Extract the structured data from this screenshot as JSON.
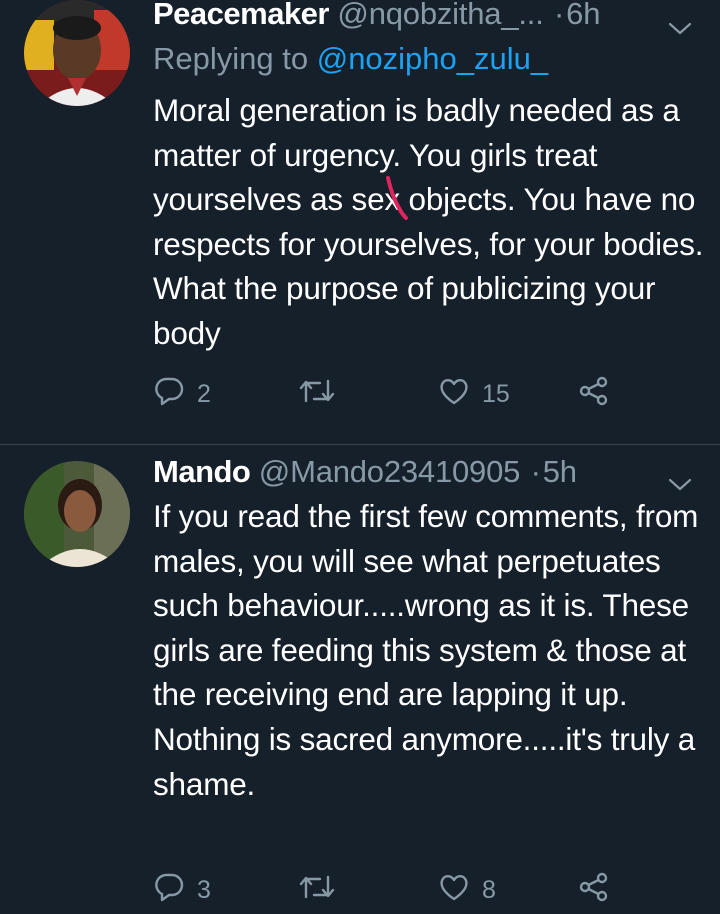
{
  "tweets": [
    {
      "name": "Peacemaker",
      "handle": "@nqobzitha_...",
      "time": "6h",
      "replying_prefix": "Replying to",
      "replying_to": "@nozipho_zulu_",
      "text": "Moral generation is badly needed as a matter of urgency. You girls treat yourselves as sex objects. You have no respects for yourselves, for your bodies. What the purpose of publicizing your body",
      "reply_count": "2",
      "retweet_count": "",
      "like_count": "15"
    },
    {
      "name": "Mando",
      "handle": "@Mando23410905",
      "time": "5h",
      "text": "If you read the first few comments, from males, you will see what perpetuates such behaviour.....wrong as it is. These girls are feeding this system & those at the receiving end are lapping it up. Nothing is sacred anymore.....it's truly a shame.",
      "reply_count": "3",
      "retweet_count": "",
      "like_count": "8"
    }
  ],
  "colors": {
    "background": "#15202b",
    "secondary_text": "#8899a6",
    "link": "#1da1f2",
    "divider": "#38444d",
    "annotation": "#e0245e"
  },
  "icons": [
    "reply-icon",
    "retweet-icon",
    "like-icon",
    "share-icon",
    "caret-down-icon"
  ]
}
